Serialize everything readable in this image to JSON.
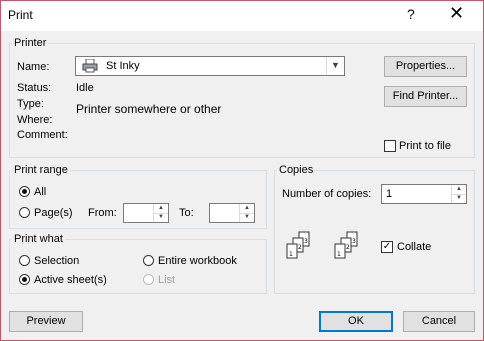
{
  "window": {
    "title": "Print",
    "help_label": "?",
    "close_label": "✕"
  },
  "printer": {
    "legend": "Printer",
    "name_label": "Name:",
    "name_value": "St Inky",
    "status_label": "Status:",
    "status_value": "Idle",
    "type_label": "Type:",
    "type_value": "Printer somewhere or other",
    "where_label": "Where:",
    "comment_label": "Comment:",
    "properties_label": "Properties...",
    "find_printer_label": "Find Printer...",
    "print_to_file_label": "Print to file"
  },
  "print_range": {
    "legend": "Print range",
    "all_label": "All",
    "pages_label": "Page(s)",
    "from_label": "From:",
    "to_label": "To:",
    "selected": "all"
  },
  "print_what": {
    "legend": "Print what",
    "selection_label": "Selection",
    "entire_workbook_label": "Entire workbook",
    "active_sheets_label": "Active sheet(s)",
    "list_label": "List",
    "selected": "active_sheets"
  },
  "copies": {
    "legend": "Copies",
    "number_label": "Number of copies:",
    "number_value": "1",
    "collate_label": "Collate",
    "collate_checked": true
  },
  "footer": {
    "preview_label": "Preview",
    "ok_label": "OK",
    "cancel_label": "Cancel"
  }
}
